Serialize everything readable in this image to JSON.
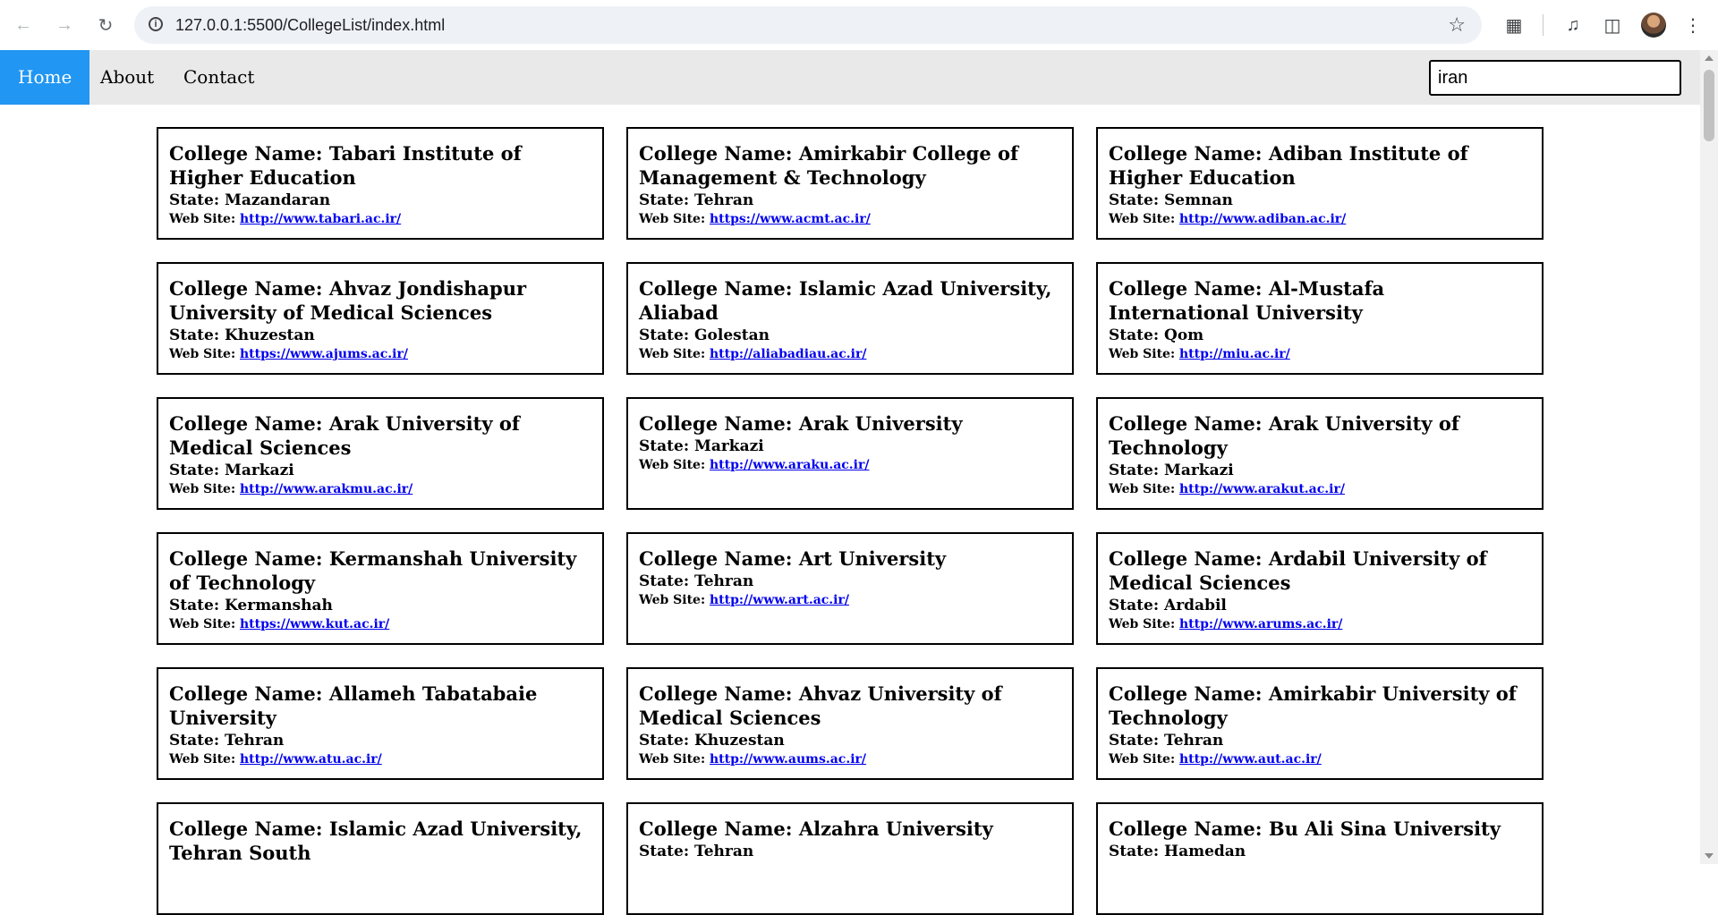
{
  "browser": {
    "url": "127.0.0.1:5500/CollegeList/index.html"
  },
  "nav": {
    "items": [
      "Home",
      "About",
      "Contact"
    ],
    "search_value": "iran"
  },
  "labels": {
    "college_name": "College Name: ",
    "state": "State: ",
    "web_site": "Web Site: "
  },
  "colleges": [
    {
      "name": "Tabari Institute of Higher Education",
      "state": "Mazandaran",
      "web": "http://www.tabari.ac.ir/"
    },
    {
      "name": "Amirkabir College of Management & Technology",
      "state": "Tehran",
      "web": "https://www.acmt.ac.ir/"
    },
    {
      "name": "Adiban Institute of Higher Education",
      "state": "Semnan",
      "web": "http://www.adiban.ac.ir/"
    },
    {
      "name": "Ahvaz Jondishapur University of Medical Sciences",
      "state": "Khuzestan",
      "web": "https://www.ajums.ac.ir/"
    },
    {
      "name": "Islamic Azad University, Aliabad",
      "state": "Golestan",
      "web": "http://aliabadiau.ac.ir/"
    },
    {
      "name": "Al-Mustafa International University",
      "state": "Qom",
      "web": "http://miu.ac.ir/"
    },
    {
      "name": "Arak University of Medical Sciences",
      "state": "Markazi",
      "web": "http://www.arakmu.ac.ir/"
    },
    {
      "name": "Arak University",
      "state": "Markazi",
      "web": "http://www.araku.ac.ir/"
    },
    {
      "name": "Arak University of Technology",
      "state": "Markazi",
      "web": "http://www.arakut.ac.ir/"
    },
    {
      "name": "Kermanshah University of Technology",
      "state": "Kermanshah",
      "web": "https://www.kut.ac.ir/"
    },
    {
      "name": "Art University",
      "state": "Tehran",
      "web": "http://www.art.ac.ir/"
    },
    {
      "name": "Ardabil University of Medical Sciences",
      "state": "Ardabil",
      "web": "http://www.arums.ac.ir/"
    },
    {
      "name": "Allameh Tabatabaie University",
      "state": "Tehran",
      "web": "http://www.atu.ac.ir/"
    },
    {
      "name": "Ahvaz University of Medical Sciences",
      "state": "Khuzestan",
      "web": "http://www.aums.ac.ir/"
    },
    {
      "name": "Amirkabir University of Technology",
      "state": "Tehran",
      "web": "http://www.aut.ac.ir/"
    },
    {
      "name": "Islamic Azad University, Tehran South",
      "state": "",
      "web": ""
    },
    {
      "name": "Alzahra University",
      "state": "Tehran",
      "web": ""
    },
    {
      "name": "Bu Ali Sina University",
      "state": "Hamedan",
      "web": ""
    }
  ]
}
